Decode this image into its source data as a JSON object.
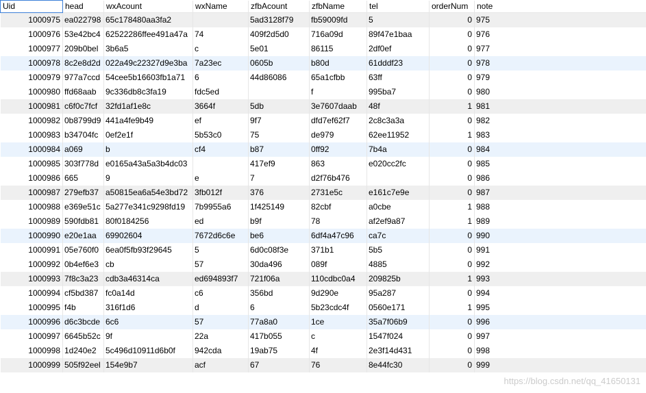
{
  "columns": [
    "Uid",
    "head",
    "wxAcount",
    "wxName",
    "zfbAcount",
    "zfbName",
    "tel",
    "orderNum",
    "note"
  ],
  "row_colors": {
    "white": "#ffffff",
    "gray": "#efefef",
    "blue": "#eaf3fd",
    "header_outline": "#3c7fd8"
  },
  "rows": [
    {
      "shade": "gray",
      "cells": [
        "1000975",
        "ea022798",
        "65c178480aa3fa2",
        "",
        "5ad3128f79",
        "fb59009fd",
        "5",
        "0",
        "975"
      ]
    },
    {
      "shade": "white",
      "cells": [
        "1000976",
        "53e42bc4",
        "62522286ffee491a47a",
        "74",
        "409f2d5d0",
        "716a09d",
        "89f47e1baa",
        "0",
        "976"
      ]
    },
    {
      "shade": "white",
      "cells": [
        "1000977",
        "209b0bel",
        "3b6a5",
        "c",
        "5e01",
        "86115",
        "2df0ef",
        "0",
        "977"
      ]
    },
    {
      "shade": "blue",
      "cells": [
        "1000978",
        "8c2e8d2d",
        "022a49c22327d9e3ba",
        "7a23ec",
        "0605b",
        "b80d",
        "61dddf23",
        "0",
        "978"
      ]
    },
    {
      "shade": "white",
      "cells": [
        "1000979",
        "977a7ccd",
        "54cee5b16603fb1a71",
        "6",
        "44d86086",
        "65a1cfbb",
        "63ff",
        "0",
        "979"
      ]
    },
    {
      "shade": "white",
      "cells": [
        "1000980",
        "ffd68aab",
        "9c336db8c3fa19",
        "fdc5ed",
        "",
        "f",
        "995ba7",
        "0",
        "980"
      ]
    },
    {
      "shade": "gray",
      "cells": [
        "1000981",
        "c6f0c7fcf",
        "32fd1af1e8c",
        "3664f",
        "5db",
        "3e7607daab",
        "48f",
        "1",
        "981"
      ]
    },
    {
      "shade": "white",
      "cells": [
        "1000982",
        "0b8799d9",
        "441a4fe9b49",
        "ef",
        "9f7",
        "dfd7ef62f7",
        "2c8c3a3a",
        "0",
        "982"
      ]
    },
    {
      "shade": "white",
      "cells": [
        "1000983",
        "b34704fc",
        "0ef2e1f",
        "5b53c0",
        "75",
        "de979",
        "62ee11952",
        "1",
        "983"
      ]
    },
    {
      "shade": "blue",
      "cells": [
        "1000984",
        "a069",
        "b",
        "cf4",
        "b87",
        "0ff92",
        "7b4a",
        "0",
        "984"
      ]
    },
    {
      "shade": "white",
      "cells": [
        "1000985",
        "303f778d",
        "e0165a43a5a3b4dc03",
        "",
        "417ef9",
        "863",
        "e020cc2fc",
        "0",
        "985"
      ]
    },
    {
      "shade": "white",
      "cells": [
        "1000986",
        "665",
        "9",
        "e",
        "7",
        "d2f76b476",
        "",
        "0",
        "986"
      ]
    },
    {
      "shade": "gray",
      "cells": [
        "1000987",
        "279efb37",
        "a50815ea6a54e3bd72",
        "3fb012f",
        "376",
        "2731e5c",
        "e161c7e9e",
        "0",
        "987"
      ]
    },
    {
      "shade": "white",
      "cells": [
        "1000988",
        "e369e51c",
        "5a277e341c9298fd19",
        "7b9955a6",
        "1f425149",
        "82cbf",
        "a0cbe",
        "1",
        "988"
      ]
    },
    {
      "shade": "white",
      "cells": [
        "1000989",
        "590fdb81",
        "80f0184256",
        "ed",
        "b9f",
        "78",
        "af2ef9a87",
        "1",
        "989"
      ]
    },
    {
      "shade": "blue",
      "cells": [
        "1000990",
        "e20e1aa",
        "69902604",
        "7672d6c6e",
        "be6",
        "6df4a47c96",
        "ca7c",
        "0",
        "990"
      ]
    },
    {
      "shade": "white",
      "cells": [
        "1000991",
        "05e760f0",
        "6ea0f5fb93f29645",
        "5",
        "6d0c08f3e",
        "371b1",
        "5b5",
        "0",
        "991"
      ]
    },
    {
      "shade": "white",
      "cells": [
        "1000992",
        "0b4ef6e3",
        "cb",
        "57",
        "30da496",
        "089f",
        "4885",
        "0",
        "992"
      ]
    },
    {
      "shade": "gray",
      "cells": [
        "1000993",
        "7f8c3a23",
        "cdb3a46314ca",
        "ed694893f7",
        "721f06a",
        "110cdbc0a4",
        "209825b",
        "1",
        "993"
      ]
    },
    {
      "shade": "white",
      "cells": [
        "1000994",
        "cf5bd387",
        "fc0a14d",
        "c6",
        "356bd",
        "9d290e",
        "95a287",
        "0",
        "994"
      ]
    },
    {
      "shade": "white",
      "cells": [
        "1000995",
        "f4b",
        "316f1d6",
        "d",
        "6",
        "5b23cdc4f",
        "0560e171",
        "1",
        "995"
      ]
    },
    {
      "shade": "blue",
      "cells": [
        "1000996",
        "d6c3bcde",
        "6c6",
        "57",
        "77a8a0",
        "1ce",
        "35a7f06b9",
        "0",
        "996"
      ]
    },
    {
      "shade": "white",
      "cells": [
        "1000997",
        "6645b52c",
        "9f",
        "22a",
        "417b055",
        "c",
        "1547f024",
        "0",
        "997"
      ]
    },
    {
      "shade": "white",
      "cells": [
        "1000998",
        "1d240e2",
        "5c496d10911d6b0f",
        "942cda",
        "19ab75",
        "4f",
        "2e3f14d431",
        "0",
        "998"
      ]
    },
    {
      "shade": "gray",
      "cells": [
        "1000999",
        "505f92eel",
        "154e9b7",
        "acf",
        "67",
        "76",
        "8e44fc30",
        "0",
        "999"
      ]
    }
  ],
  "watermark": "https://blog.csdn.net/qq_41650131"
}
